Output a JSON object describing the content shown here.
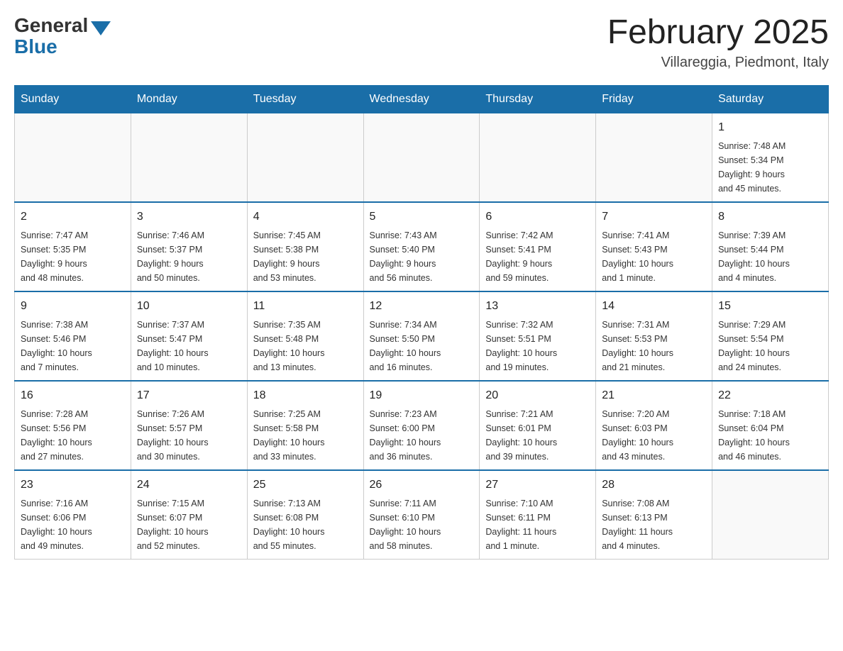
{
  "logo": {
    "general": "General",
    "blue": "Blue"
  },
  "title": "February 2025",
  "location": "Villareggia, Piedmont, Italy",
  "days_of_week": [
    "Sunday",
    "Monday",
    "Tuesday",
    "Wednesday",
    "Thursday",
    "Friday",
    "Saturday"
  ],
  "weeks": [
    [
      {
        "day": "",
        "info": ""
      },
      {
        "day": "",
        "info": ""
      },
      {
        "day": "",
        "info": ""
      },
      {
        "day": "",
        "info": ""
      },
      {
        "day": "",
        "info": ""
      },
      {
        "day": "",
        "info": ""
      },
      {
        "day": "1",
        "info": "Sunrise: 7:48 AM\nSunset: 5:34 PM\nDaylight: 9 hours\nand 45 minutes."
      }
    ],
    [
      {
        "day": "2",
        "info": "Sunrise: 7:47 AM\nSunset: 5:35 PM\nDaylight: 9 hours\nand 48 minutes."
      },
      {
        "day": "3",
        "info": "Sunrise: 7:46 AM\nSunset: 5:37 PM\nDaylight: 9 hours\nand 50 minutes."
      },
      {
        "day": "4",
        "info": "Sunrise: 7:45 AM\nSunset: 5:38 PM\nDaylight: 9 hours\nand 53 minutes."
      },
      {
        "day": "5",
        "info": "Sunrise: 7:43 AM\nSunset: 5:40 PM\nDaylight: 9 hours\nand 56 minutes."
      },
      {
        "day": "6",
        "info": "Sunrise: 7:42 AM\nSunset: 5:41 PM\nDaylight: 9 hours\nand 59 minutes."
      },
      {
        "day": "7",
        "info": "Sunrise: 7:41 AM\nSunset: 5:43 PM\nDaylight: 10 hours\nand 1 minute."
      },
      {
        "day": "8",
        "info": "Sunrise: 7:39 AM\nSunset: 5:44 PM\nDaylight: 10 hours\nand 4 minutes."
      }
    ],
    [
      {
        "day": "9",
        "info": "Sunrise: 7:38 AM\nSunset: 5:46 PM\nDaylight: 10 hours\nand 7 minutes."
      },
      {
        "day": "10",
        "info": "Sunrise: 7:37 AM\nSunset: 5:47 PM\nDaylight: 10 hours\nand 10 minutes."
      },
      {
        "day": "11",
        "info": "Sunrise: 7:35 AM\nSunset: 5:48 PM\nDaylight: 10 hours\nand 13 minutes."
      },
      {
        "day": "12",
        "info": "Sunrise: 7:34 AM\nSunset: 5:50 PM\nDaylight: 10 hours\nand 16 minutes."
      },
      {
        "day": "13",
        "info": "Sunrise: 7:32 AM\nSunset: 5:51 PM\nDaylight: 10 hours\nand 19 minutes."
      },
      {
        "day": "14",
        "info": "Sunrise: 7:31 AM\nSunset: 5:53 PM\nDaylight: 10 hours\nand 21 minutes."
      },
      {
        "day": "15",
        "info": "Sunrise: 7:29 AM\nSunset: 5:54 PM\nDaylight: 10 hours\nand 24 minutes."
      }
    ],
    [
      {
        "day": "16",
        "info": "Sunrise: 7:28 AM\nSunset: 5:56 PM\nDaylight: 10 hours\nand 27 minutes."
      },
      {
        "day": "17",
        "info": "Sunrise: 7:26 AM\nSunset: 5:57 PM\nDaylight: 10 hours\nand 30 minutes."
      },
      {
        "day": "18",
        "info": "Sunrise: 7:25 AM\nSunset: 5:58 PM\nDaylight: 10 hours\nand 33 minutes."
      },
      {
        "day": "19",
        "info": "Sunrise: 7:23 AM\nSunset: 6:00 PM\nDaylight: 10 hours\nand 36 minutes."
      },
      {
        "day": "20",
        "info": "Sunrise: 7:21 AM\nSunset: 6:01 PM\nDaylight: 10 hours\nand 39 minutes."
      },
      {
        "day": "21",
        "info": "Sunrise: 7:20 AM\nSunset: 6:03 PM\nDaylight: 10 hours\nand 43 minutes."
      },
      {
        "day": "22",
        "info": "Sunrise: 7:18 AM\nSunset: 6:04 PM\nDaylight: 10 hours\nand 46 minutes."
      }
    ],
    [
      {
        "day": "23",
        "info": "Sunrise: 7:16 AM\nSunset: 6:06 PM\nDaylight: 10 hours\nand 49 minutes."
      },
      {
        "day": "24",
        "info": "Sunrise: 7:15 AM\nSunset: 6:07 PM\nDaylight: 10 hours\nand 52 minutes."
      },
      {
        "day": "25",
        "info": "Sunrise: 7:13 AM\nSunset: 6:08 PM\nDaylight: 10 hours\nand 55 minutes."
      },
      {
        "day": "26",
        "info": "Sunrise: 7:11 AM\nSunset: 6:10 PM\nDaylight: 10 hours\nand 58 minutes."
      },
      {
        "day": "27",
        "info": "Sunrise: 7:10 AM\nSunset: 6:11 PM\nDaylight: 11 hours\nand 1 minute."
      },
      {
        "day": "28",
        "info": "Sunrise: 7:08 AM\nSunset: 6:13 PM\nDaylight: 11 hours\nand 4 minutes."
      },
      {
        "day": "",
        "info": ""
      }
    ]
  ]
}
